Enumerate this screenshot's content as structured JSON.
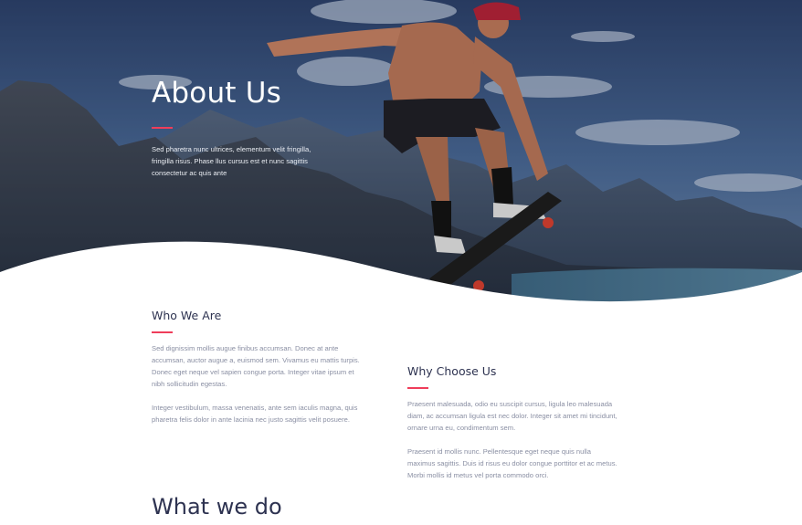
{
  "hero": {
    "title": "About Us",
    "text": "Sed pharetra nunc ultrices, elementum velit fringilla, fringilla risus. Phase llus cursus est et nunc sagittis consectetur ac quis ante",
    "image": "skateboarder-jumping-over-mountain-lake",
    "accent_color": "#ef3d5a"
  },
  "who_we_are": {
    "title": "Who We Are",
    "paragraph_1": "Sed dignissim mollis augue finibus accumsan. Donec at ante accumsan, auctor augue a, euismod sem. Vivamus eu mattis turpis. Donec eget neque vel sapien congue porta. Integer vitae ipsum et nibh sollicitudin egestas.",
    "paragraph_2": "Integer vestibulum, massa venenatis, ante sem iaculis magna, quis pharetra felis dolor in ante lacinia nec justo sagittis velit posuere."
  },
  "why_choose_us": {
    "title": "Why Choose Us",
    "paragraph_1": "Praesent malesuada, odio eu suscipit cursus, ligula leo malesuada diam, ac accumsan ligula est nec dolor. Integer sit amet mi tincidunt, ornare urna eu, condimentum sem.",
    "paragraph_2": "Praesent id mollis nunc. Pellentesque eget neque quis nulla maximus sagittis. Duis id risus eu dolor congue porttitor et ac metus. Morbi mollis id metus vel porta commodo orci."
  },
  "what_we_do": {
    "title": "What we do"
  },
  "colors": {
    "heading": "#2e3351",
    "body_text": "#8a8fa3",
    "accent": "#ef3d5a"
  }
}
